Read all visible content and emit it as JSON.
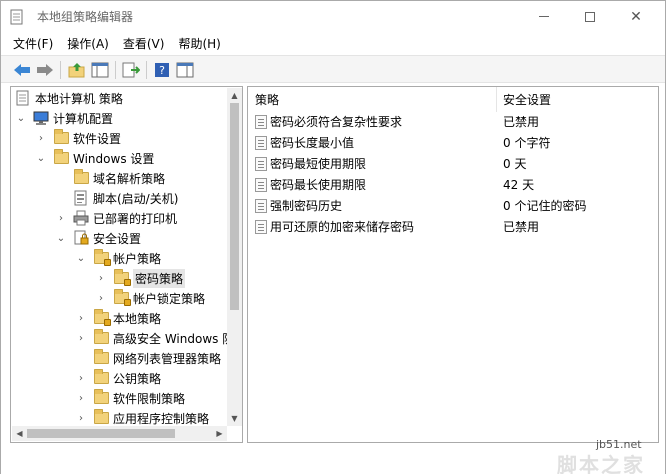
{
  "window": {
    "title": "本地组策略编辑器",
    "close_glyph": "✕"
  },
  "menu": {
    "items": [
      "文件(F)",
      "操作(A)",
      "查看(V)",
      "帮助(H)"
    ]
  },
  "toolbar": {
    "icons": [
      "back-arrow-icon",
      "forward-arrow-icon",
      "up-folder-icon",
      "show-hide-tree-icon",
      "export-list-icon",
      "help-icon",
      "properties-pane-icon"
    ]
  },
  "tree": {
    "items": [
      {
        "label": "本地计算机 策略",
        "icon": "policy-doc-icon",
        "expander": ""
      },
      {
        "label": "计算机配置",
        "icon": "computer-icon",
        "expander": "⌄"
      },
      {
        "label": "软件设置",
        "icon": "folder-icon",
        "expander": "›"
      },
      {
        "label": "Windows 设置",
        "icon": "folder-icon",
        "expander": "⌄"
      },
      {
        "label": "域名解析策略",
        "icon": "folder-icon",
        "expander": ""
      },
      {
        "label": "脚本(启动/关机)",
        "icon": "script-icon",
        "expander": ""
      },
      {
        "label": "已部署的打印机",
        "icon": "printer-icon",
        "expander": "›"
      },
      {
        "label": "安全设置",
        "icon": "security-icon",
        "expander": "⌄"
      },
      {
        "label": "帐户策略",
        "icon": "folder-lock-icon",
        "expander": "⌄"
      },
      {
        "label": "密码策略",
        "icon": "folder-lock-icon",
        "expander": "›"
      },
      {
        "label": "帐户锁定策略",
        "icon": "folder-lock-icon",
        "expander": "›"
      },
      {
        "label": "本地策略",
        "icon": "folder-lock-icon",
        "expander": "›"
      },
      {
        "label": "高级安全 Windows 防",
        "icon": "folder-icon",
        "expander": "›"
      },
      {
        "label": "网络列表管理器策略",
        "icon": "folder-icon",
        "expander": ""
      },
      {
        "label": "公钥策略",
        "icon": "folder-icon",
        "expander": "›"
      },
      {
        "label": "软件限制策略",
        "icon": "folder-icon",
        "expander": "›"
      },
      {
        "label": "应用程序控制策略",
        "icon": "folder-icon",
        "expander": "›"
      }
    ]
  },
  "list": {
    "columns": {
      "policy": "策略",
      "setting": "安全设置"
    },
    "sort_caret": "^",
    "rows": [
      {
        "policy": "密码必须符合复杂性要求",
        "setting": "已禁用"
      },
      {
        "policy": "密码长度最小值",
        "setting": "0 个字符"
      },
      {
        "policy": "密码最短使用期限",
        "setting": "0 天"
      },
      {
        "policy": "密码最长使用期限",
        "setting": "42 天"
      },
      {
        "policy": "强制密码历史",
        "setting": "0 个记住的密码"
      },
      {
        "policy": "用可还原的加密来储存密码",
        "setting": "已禁用"
      }
    ]
  },
  "watermark": {
    "site": "jb51.net",
    "brand": "脚本之家"
  }
}
